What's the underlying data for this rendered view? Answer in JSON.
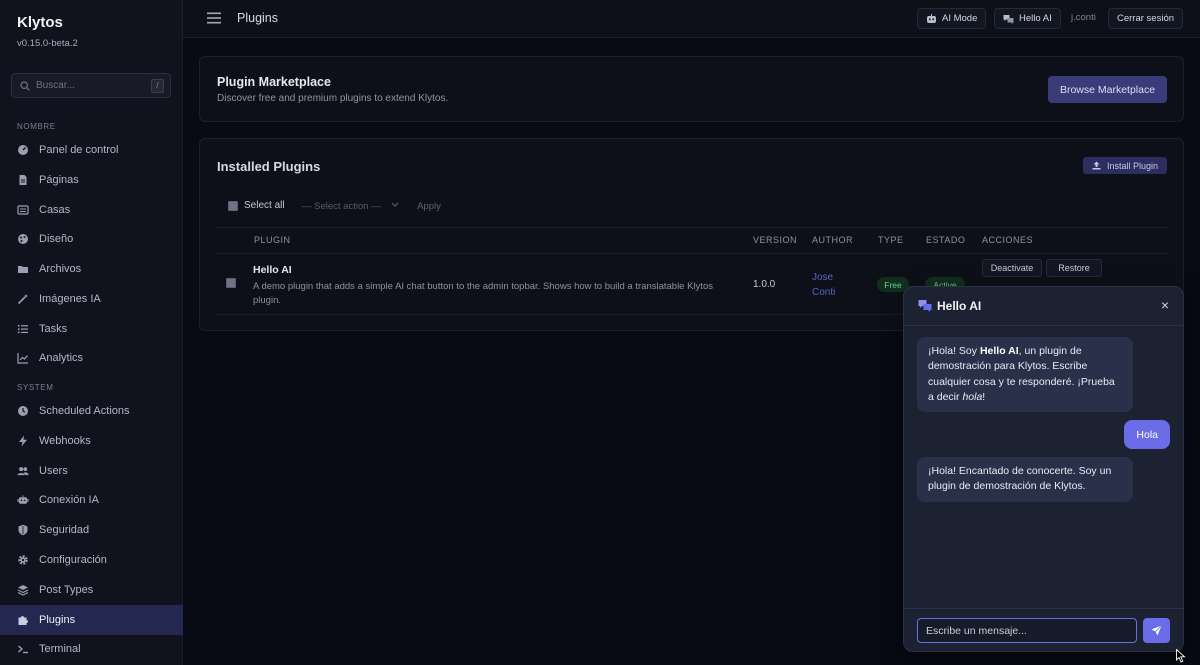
{
  "sidebar": {
    "brand": "Klytos",
    "version": "v0.15.0-beta.2",
    "search_placeholder": "Buscar...",
    "search_shortcut": "/",
    "section_main": "NOMBRE",
    "section_system": "SYSTEM",
    "items": [
      {
        "label": "Panel de control",
        "icon": "gauge-icon"
      },
      {
        "label": "Páginas",
        "icon": "document-icon"
      },
      {
        "label": "Casas",
        "icon": "newspaper-icon"
      },
      {
        "label": "Diseño",
        "icon": "palette-icon"
      },
      {
        "label": "Archivos",
        "icon": "folder-icon"
      },
      {
        "label": "Imágenes IA",
        "icon": "magic-wand-icon"
      },
      {
        "label": "Tasks",
        "icon": "list-icon"
      },
      {
        "label": "Analytics",
        "icon": "chart-icon"
      }
    ],
    "system_items": [
      {
        "label": "Scheduled Actions",
        "icon": "clock-icon"
      },
      {
        "label": "Webhooks",
        "icon": "bolt-icon"
      },
      {
        "label": "Users",
        "icon": "users-icon"
      },
      {
        "label": "Conexión IA",
        "icon": "robot-icon"
      },
      {
        "label": "Seguridad",
        "icon": "shield-icon"
      },
      {
        "label": "Configuración",
        "icon": "gear-icon"
      },
      {
        "label": "Post Types",
        "icon": "layers-icon"
      },
      {
        "label": "Plugins",
        "icon": "puzzle-icon",
        "active": true
      },
      {
        "label": "Terminal",
        "icon": "terminal-icon"
      }
    ]
  },
  "topbar": {
    "title": "Plugins",
    "ai_mode": "AI Mode",
    "hello_ai": "Hello AI",
    "user": "j.conti",
    "logout": "Cerrar sesión"
  },
  "marketplace": {
    "title": "Plugin Marketplace",
    "subtitle": "Discover free and premium plugins to extend Klytos.",
    "browse_label": "Browse Marketplace"
  },
  "installed": {
    "title": "Installed Plugins",
    "install_label": "Install Plugin",
    "select_all": "Select all",
    "bulk_placeholder": "— Select action —",
    "apply_label": "Apply",
    "columns": [
      "PLUGIN",
      "VERSION",
      "AUTHOR",
      "TYPE",
      "ESTADO",
      "ACCIONES"
    ],
    "rows": [
      {
        "name": "Hello AI",
        "description": "A demo plugin that adds a simple AI chat button to the admin topbar. Shows how to build a translatable Klytos plugin.",
        "version": "1.0.0",
        "author": "Jose Conti",
        "type": "Free",
        "state": "Active",
        "actions": [
          "Deactivate",
          "Restore"
        ]
      }
    ]
  },
  "chat": {
    "title": "Hello AI",
    "close": "×",
    "messages": [
      {
        "from": "bot",
        "text_1": "¡Hola! Soy ",
        "bold": "Hello AI",
        "text_2": ", un plugin de demostración para Klytos. Escribe cualquier cosa y te responderé. ¡Prueba a decir ",
        "italic": "hola",
        "text_3": "!"
      },
      {
        "from": "user",
        "text": "Hola"
      },
      {
        "from": "bot",
        "text": "¡Hola! Encantado de conocerte. Soy un plugin de demostración de Klytos."
      }
    ],
    "input_placeholder": "Escribe un mensaje..."
  },
  "colors": {
    "accent": "#6b6de8",
    "active_nav": "#242850",
    "success": "#6ad19a"
  }
}
